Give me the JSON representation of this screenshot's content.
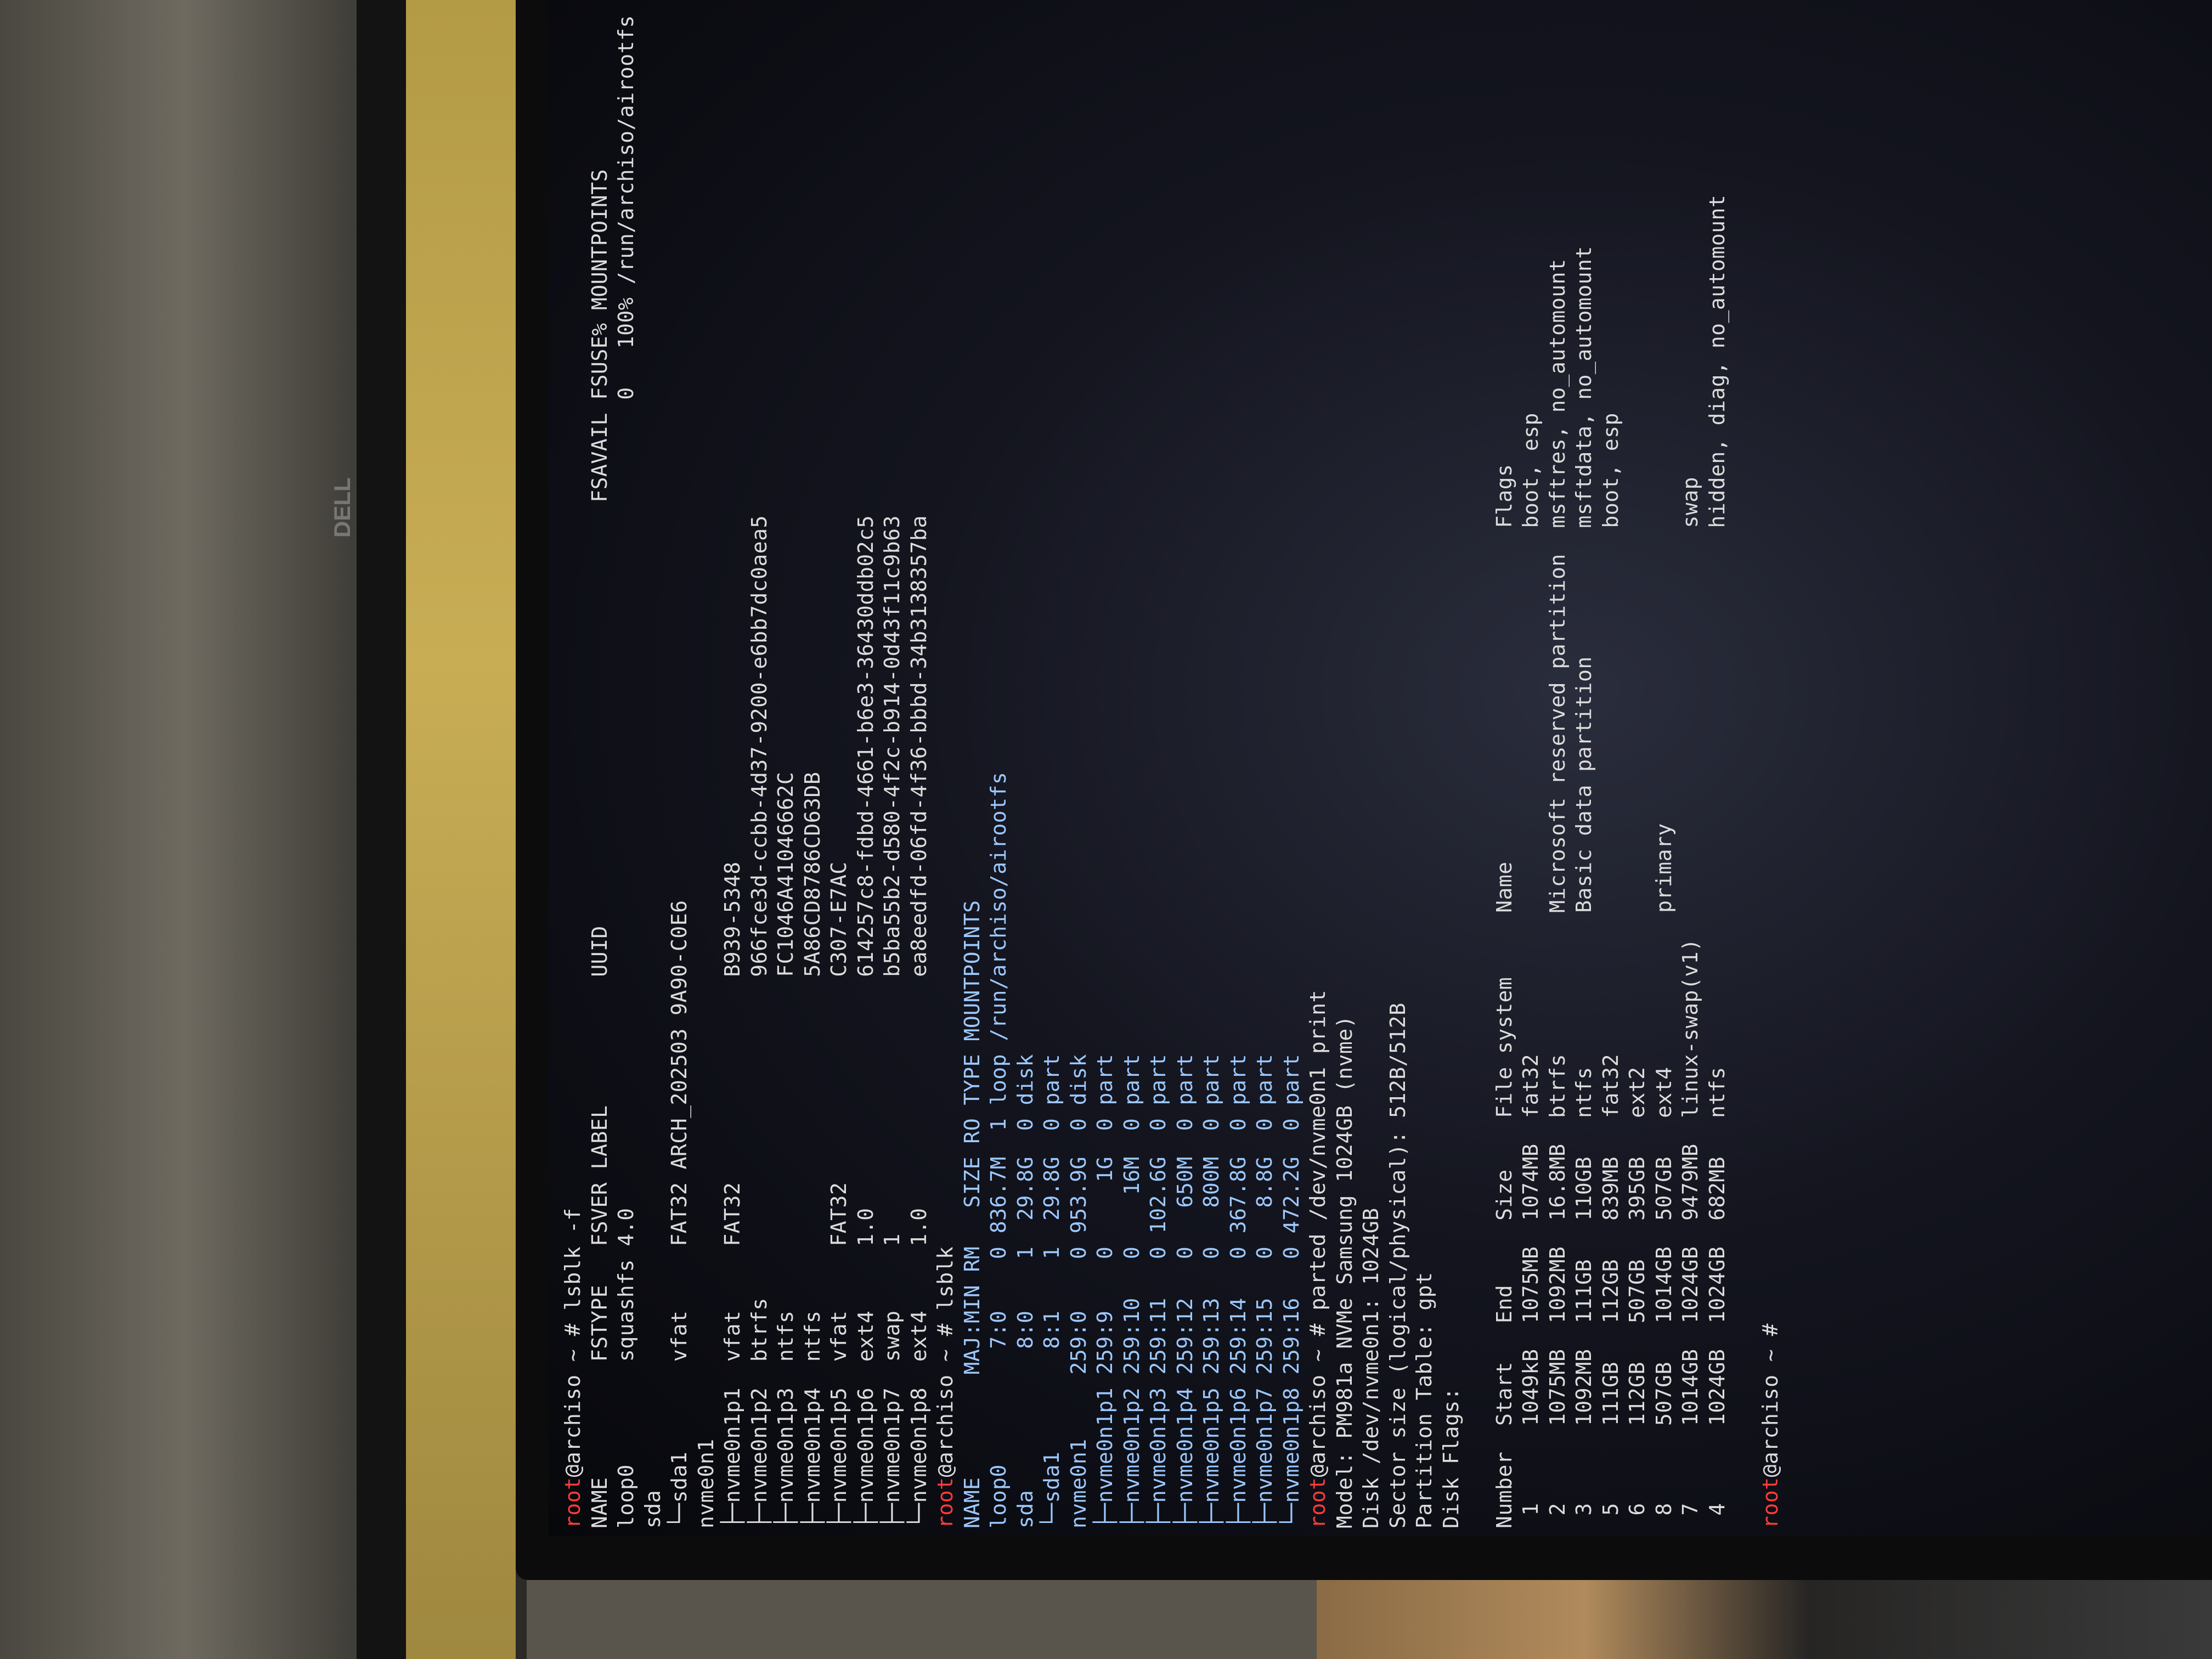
{
  "brand": "DELL",
  "terminal": {
    "prompt_user": "root",
    "prompt_rest": "@archiso ~ # ",
    "lines": [
      {
        "type": "prompt",
        "cmd": "lsblk -f"
      },
      {
        "type": "text",
        "text": "NAME         FSTYPE   FSVER LABEL          UUID                                 FSAVAIL FSUSE% MOUNTPOINTS",
        "color": "white"
      },
      {
        "type": "text",
        "text": "loop0        squashfs 4.0                                                               0   100% /run/archiso/airootfs",
        "color": "white"
      },
      {
        "type": "text",
        "text": "sda",
        "color": "white"
      },
      {
        "type": "text",
        "text": "└─sda1       vfat     FAT32 ARCH_202503 9A90-C0E6",
        "color": "white"
      },
      {
        "type": "text",
        "text": "nvme0n1",
        "color": "white"
      },
      {
        "type": "text",
        "text": "├─nvme0n1p1  vfat     FAT32                B939-5348",
        "color": "white"
      },
      {
        "type": "text",
        "text": "├─nvme0n1p2  btrfs                         966fce3d-ccbb-4d37-9200-e6bb7dc0aea5",
        "color": "white"
      },
      {
        "type": "text",
        "text": "├─nvme0n1p3  ntfs                          FC1046A41046662C",
        "color": "white"
      },
      {
        "type": "text",
        "text": "├─nvme0n1p4  ntfs                          5A86CD8786CD63DB",
        "color": "white"
      },
      {
        "type": "text",
        "text": "├─nvme0n1p5  vfat     FAT32                C307-E7AC",
        "color": "white"
      },
      {
        "type": "text",
        "text": "├─nvme0n1p6  ext4     1.0                  614257c8-fdbd-4661-b6e3-36430ddb02c5",
        "color": "white"
      },
      {
        "type": "text",
        "text": "├─nvme0n1p7  swap     1                    b5ba55b2-d580-4f2c-b914-0d43f11c9b63",
        "color": "white"
      },
      {
        "type": "text",
        "text": "└─nvme0n1p8  ext4     1.0                  ea8eedfd-06fd-4f36-bbbd-34b3138357ba",
        "color": "white"
      },
      {
        "type": "prompt",
        "cmd": "lsblk"
      },
      {
        "type": "text",
        "text": "NAME        MAJ:MIN RM   SIZE RO TYPE MOUNTPOINTS",
        "color": "blue"
      },
      {
        "type": "text",
        "text": "loop0         7:0    0 836.7M  1 loop /run/archiso/airootfs",
        "color": "blue"
      },
      {
        "type": "text",
        "text": "sda           8:0    1  29.8G  0 disk",
        "color": "blue"
      },
      {
        "type": "text",
        "text": "└─sda1        8:1    1  29.8G  0 part",
        "color": "blue"
      },
      {
        "type": "text",
        "text": "nvme0n1     259:0    0 953.9G  0 disk",
        "color": "blue"
      },
      {
        "type": "text",
        "text": "├─nvme0n1p1 259:9    0     1G  0 part",
        "color": "blue"
      },
      {
        "type": "text",
        "text": "├─nvme0n1p2 259:10   0    16M  0 part",
        "color": "blue"
      },
      {
        "type": "text",
        "text": "├─nvme0n1p3 259:11   0 102.6G  0 part",
        "color": "blue"
      },
      {
        "type": "text",
        "text": "├─nvme0n1p4 259:12   0   650M  0 part",
        "color": "blue"
      },
      {
        "type": "text",
        "text": "├─nvme0n1p5 259:13   0   800M  0 part",
        "color": "blue"
      },
      {
        "type": "text",
        "text": "├─nvme0n1p6 259:14   0 367.8G  0 part",
        "color": "blue"
      },
      {
        "type": "text",
        "text": "├─nvme0n1p7 259:15   0   8.8G  0 part",
        "color": "blue"
      },
      {
        "type": "text",
        "text": "└─nvme0n1p8 259:16   0 472.2G  0 part",
        "color": "blue"
      },
      {
        "type": "prompt",
        "cmd": "parted /dev/nvme0n1 print"
      },
      {
        "type": "text",
        "text": "Model: PM981a NVMe Samsung 1024GB (nvme)",
        "color": "white"
      },
      {
        "type": "text",
        "text": "Disk /dev/nvme0n1: 1024GB",
        "color": "white"
      },
      {
        "type": "text",
        "text": "Sector size (logical/physical): 512B/512B",
        "color": "white"
      },
      {
        "type": "text",
        "text": "Partition Table: gpt",
        "color": "white"
      },
      {
        "type": "text",
        "text": "Disk Flags:",
        "color": "white"
      },
      {
        "type": "text",
        "text": "",
        "color": "white"
      },
      {
        "type": "text",
        "text": "Number  Start   End     Size    File system     Name                          Flags",
        "color": "white"
      },
      {
        "type": "text",
        "text": " 1      1049kB  1075MB  1074MB  fat32                                         boot, esp",
        "color": "white"
      },
      {
        "type": "text",
        "text": " 2      1075MB  1092MB  16.8MB  btrfs           Microsoft reserved partition  msftres, no_automount",
        "color": "white"
      },
      {
        "type": "text",
        "text": " 3      1092MB  111GB   110GB   ntfs            Basic data partition          msftdata, no_automount",
        "color": "white"
      },
      {
        "type": "text",
        "text": " 5      111GB   112GB   839MB   fat32                                         boot, esp",
        "color": "white"
      },
      {
        "type": "text",
        "text": " 6      112GB   507GB   395GB   ext2",
        "color": "white"
      },
      {
        "type": "text",
        "text": " 8      507GB   1014GB  507GB   ext4            primary",
        "color": "white"
      },
      {
        "type": "text",
        "text": " 7      1014GB  1024GB  9479MB  linux-swap(v1)                                swap",
        "color": "white"
      },
      {
        "type": "text",
        "text": " 4      1024GB  1024GB  682MB   ntfs                                          hidden, diag, no_automount",
        "color": "white"
      },
      {
        "type": "text",
        "text": "",
        "color": "white"
      },
      {
        "type": "prompt",
        "cmd": ""
      }
    ]
  }
}
